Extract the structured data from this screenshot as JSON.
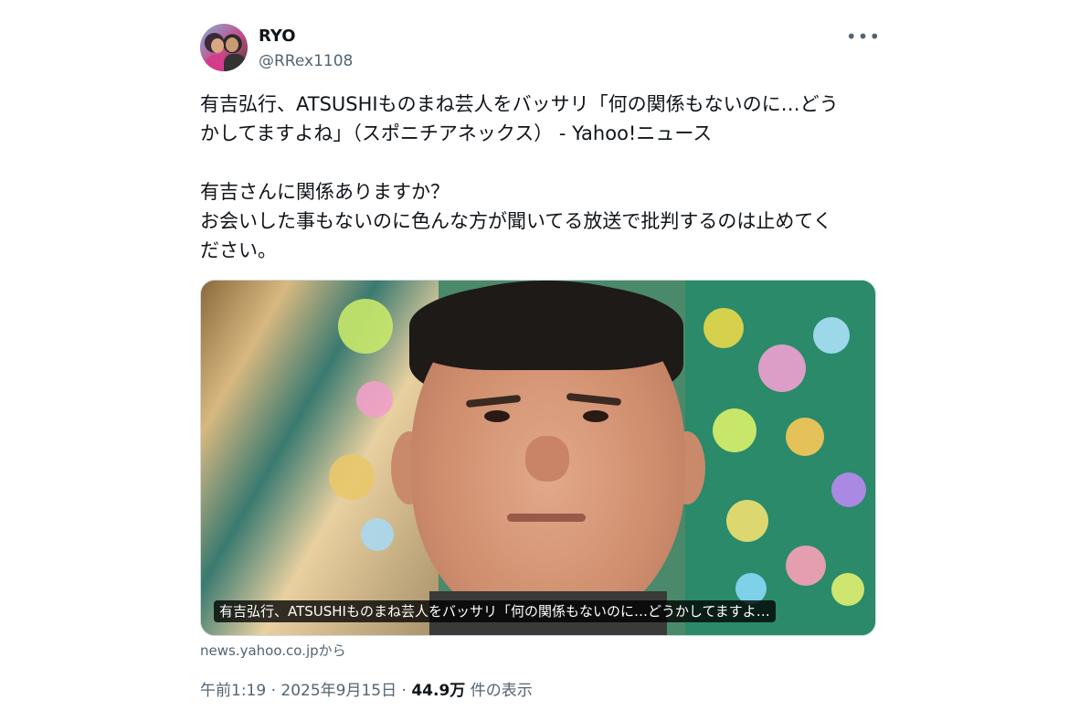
{
  "author": {
    "display_name": "RYO",
    "handle": "@RRex1108"
  },
  "more_button_label": "•••",
  "tweet": {
    "text": "有吉弘行、ATSUSHIものまね芸人をバッサリ「何の関係もないのに…どう\nかしてますよね」（スポニチアネックス） - Yahoo!ニュース\n\n有吉さんに関係ありますか？\nお会いした事もないのに色んな方が聞いてる放送で批判するのは止めてく\nださい。"
  },
  "card": {
    "caption": "有吉弘行、ATSUSHIものまね芸人をバッサリ「何の関係もないのに…どうかしてますよ…",
    "source": "news.yahoo.co.jpから"
  },
  "meta": {
    "time": "午前1:19",
    "dot1": " · ",
    "date": "2025年9月15日",
    "dot2": " · ",
    "views": "44.9万",
    "views_suffix": " 件の表示"
  },
  "colors": {
    "text_primary": "#0f1419",
    "text_secondary": "#536471",
    "border": "#cfd9de"
  },
  "icons": {
    "more": "more-horizontal-icon"
  }
}
